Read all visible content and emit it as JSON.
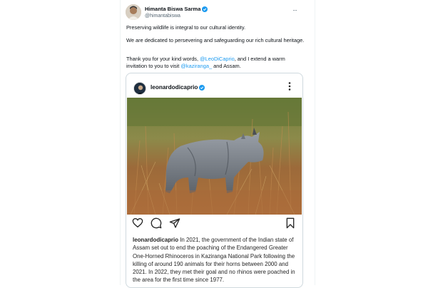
{
  "tweet": {
    "author_name": "Himanta Biswa Sarma",
    "author_handle": "@himantabiswa",
    "para1": "Preserving wildlife is integral to our cultural identity.",
    "para2": "We are dedicated to persevering and safeguarding our rich cultural heritage.",
    "para3_prefix": "Thank you for your kind words, ",
    "mention1": "@LeoDiCaprio",
    "para3_mid": ", and I extend a warm invitation to you to visit ",
    "mention2": "@kaziranga_",
    "para3_suffix": " and Assam."
  },
  "embed": {
    "username": "leonardodicaprio",
    "caption_user": "leonardodicaprio",
    "caption_text": " In 2021, the government of the Indian state of Assam set out to end the poaching of the Endangered Greater One-Horned Rhinoceros in Kaziranga National Park following the killing of around 190 animals for their horns between 2000 and 2021. In 2022, they met their goal and no rhinos were poached in the area for the first time since 1977."
  },
  "icons": {
    "verified": "verified-badge-icon",
    "more": "more-dots-icon",
    "like": "heart-icon",
    "comment": "comment-icon",
    "share": "send-icon",
    "save": "bookmark-icon"
  },
  "colors": {
    "link": "#1d9bf0",
    "verified": "#1d9bf0",
    "text": "#0f1419",
    "secondary": "#536471"
  }
}
